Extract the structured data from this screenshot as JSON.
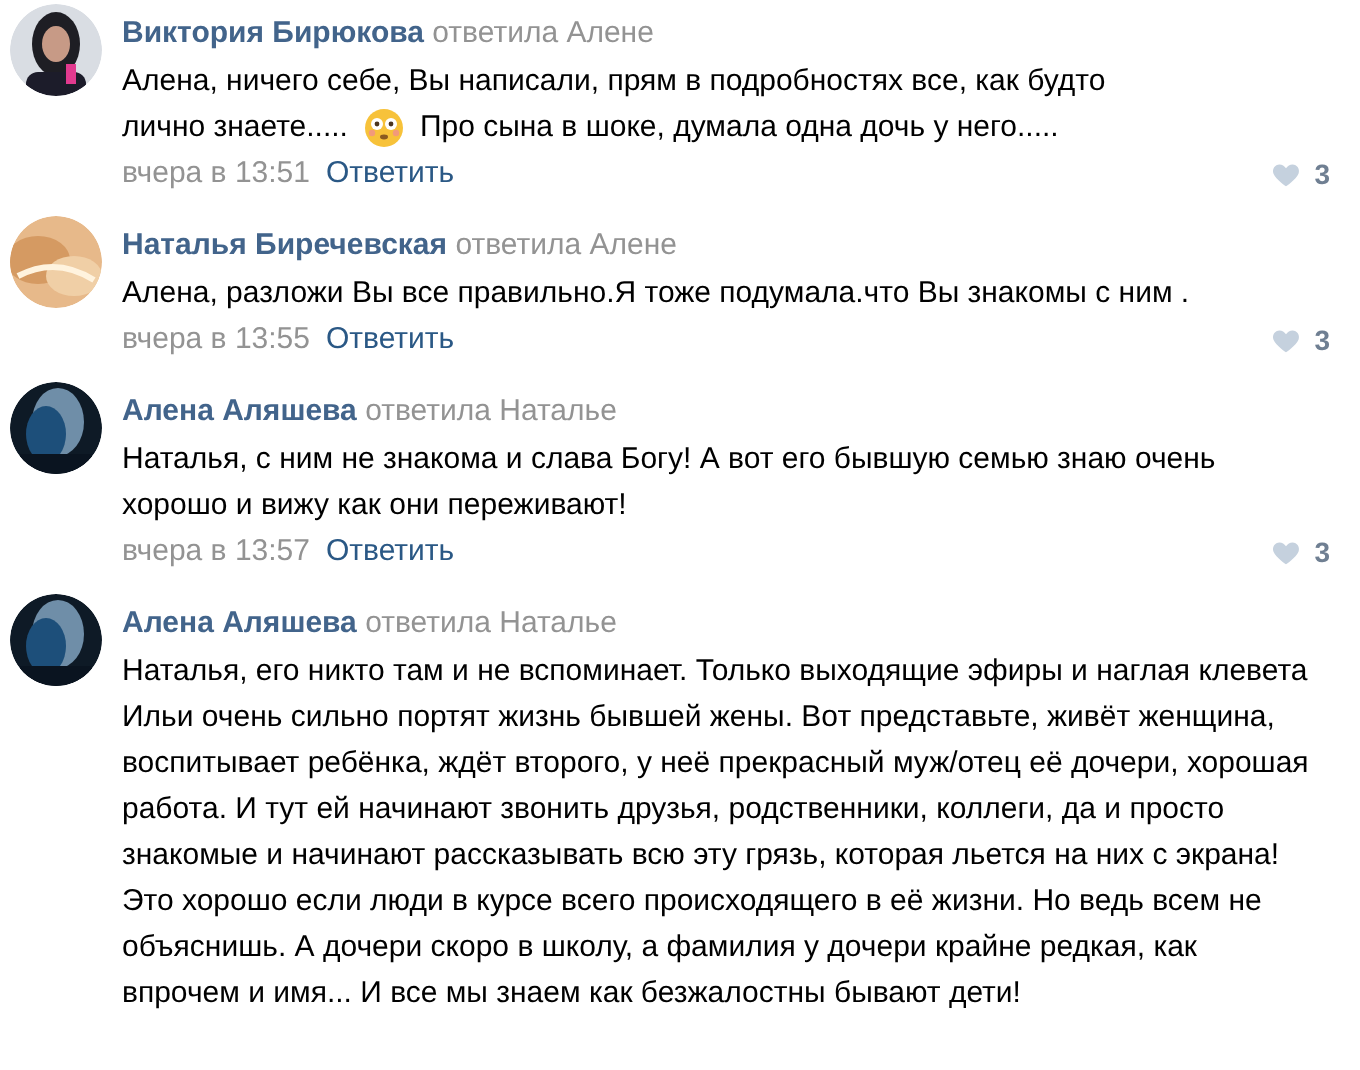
{
  "comments": [
    {
      "author": "Виктория Бирюкова",
      "reply_to": "ответила Алене",
      "avatar": {
        "kind": "picture"
      },
      "body": [
        {
          "kind": "text",
          "text": "Алена, ничего себе, Вы написали, прям в подробностях все, как будто"
        },
        {
          "kind": "line",
          "parts": [
            {
              "kind": "text",
              "text": "лично знаете....."
            },
            {
              "kind": "emoji"
            },
            {
              "kind": "text",
              "text": "Про сына в шоке, думала одна дочь у него....."
            }
          ]
        }
      ],
      "time": "вчера в 13:51",
      "reply": "Ответить",
      "likes": "3"
    },
    {
      "author": "Наталья Биречевская",
      "reply_to": "ответила Алене",
      "avatar": {
        "kind": "picture"
      },
      "body": [
        {
          "kind": "text",
          "text": "Алена, разложи Вы все правильно.Я тоже подумала.что Вы знакомы с ним ."
        }
      ],
      "time": "вчера в 13:55",
      "reply": "Ответить",
      "likes": "3"
    },
    {
      "author": "Алена Аляшева",
      "reply_to": "ответила Наталье",
      "avatar": {
        "kind": "picture"
      },
      "body": [
        {
          "kind": "text",
          "text": "Наталья, с ним не знакома и слава Богу! А вот его бывшую семью знаю очень хорошо и вижу как они переживают!"
        }
      ],
      "time": "вчера в 13:57",
      "reply": "Ответить",
      "likes": "3"
    },
    {
      "author": "Алена Аляшева",
      "reply_to": "ответила Наталье",
      "avatar": {
        "kind": "picture"
      },
      "body": [
        {
          "kind": "text",
          "text": "Наталья, его никто там и не вспоминает. Только выходящие эфиры и наглая клевета Ильи очень сильно портят жизнь бывшей жены. Вот представьте, живёт женщина, воспитывает ребёнка, ждёт второго, у неё прекрасный муж/отец её дочери, хорошая работа. И тут ей начинают звонить друзья, родственники, коллеги, да и просто знакомые и начинают рассказывать всю эту грязь, которая льется на них с экрана! Это хорошо если люди в курсе всего происходящего в её жизни. Но ведь всем не объяснишь. А дочери скоро в школу, а фамилия у дочери крайне редкая, как впрочем и имя... И все мы знаем как безжалостны бывают дети!"
        }
      ]
    }
  ]
}
